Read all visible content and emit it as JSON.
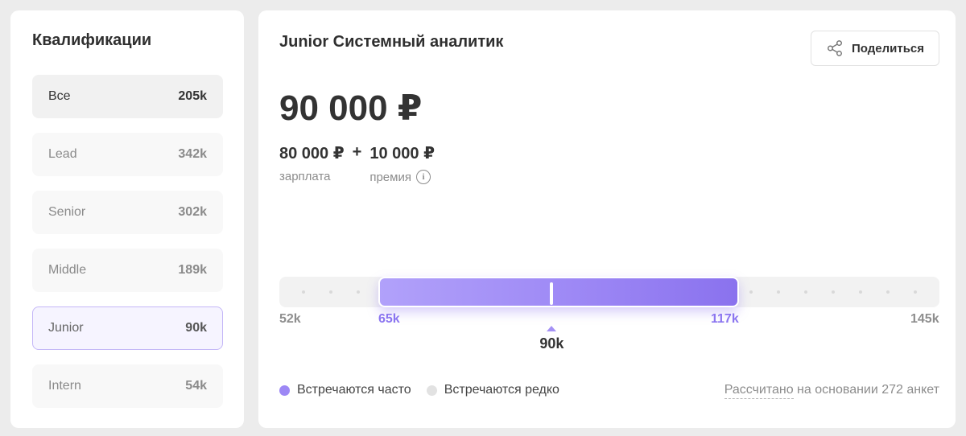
{
  "qualifications": {
    "title": "Квалификации",
    "items": [
      {
        "label": "Все",
        "value": "205k",
        "state": "all"
      },
      {
        "label": "Lead",
        "value": "342k",
        "state": ""
      },
      {
        "label": "Senior",
        "value": "302k",
        "state": ""
      },
      {
        "label": "Middle",
        "value": "189k",
        "state": ""
      },
      {
        "label": "Junior",
        "value": "90k",
        "state": "selected"
      },
      {
        "label": "Intern",
        "value": "54k",
        "state": ""
      }
    ]
  },
  "detail": {
    "title": "Junior Системный аналитик",
    "share_label": "Поделиться",
    "total": "90 000 ₽",
    "salary_amount": "80 000 ₽",
    "plus": "+",
    "salary_label": "зарплата",
    "bonus_amount": "10 000 ₽",
    "bonus_label": "премия",
    "info_glyph": "i"
  },
  "range": {
    "min": 52,
    "max": 145,
    "range_low": 65,
    "range_high": 117,
    "median": 90,
    "min_label": "52k",
    "max_label": "145k",
    "low_label": "65k",
    "high_label": "117k",
    "median_label": "90k"
  },
  "legend": {
    "frequent_label": "Встречаются часто",
    "rare_label": "Встречаются редко",
    "frequent_color": "#9d88f5",
    "rare_color": "#e2e2e2"
  },
  "footnote": {
    "prefix": "Рассчитано",
    "suffix": " на основании 272 анкет"
  }
}
